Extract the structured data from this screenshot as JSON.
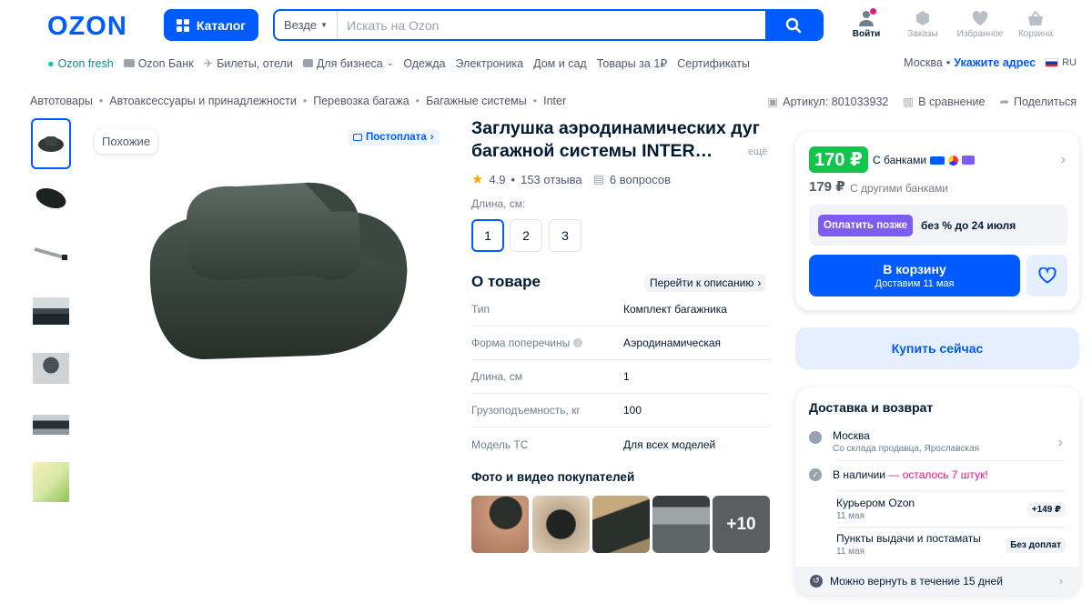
{
  "header": {
    "logo": "OZON",
    "catalog_label": "Каталог",
    "search_scope": "Везде",
    "search_placeholder": "Искать на Ozon",
    "icons": [
      {
        "label": "Войти",
        "icon": "user-icon"
      },
      {
        "label": "Заказы",
        "icon": "box-icon"
      },
      {
        "label": "Избранное",
        "icon": "heart-icon"
      },
      {
        "label": "Корзина",
        "icon": "basket-icon"
      }
    ]
  },
  "nav": {
    "items": [
      "Ozon fresh",
      "Ozon Банк",
      "Билеты, отели",
      "Для бизнеса",
      "Одежда",
      "Электроника",
      "Дом и сад",
      "Товары за 1₽",
      "Сертификаты"
    ],
    "city": "Москва",
    "address_link": "Укажите адрес",
    "lang": "RU"
  },
  "breadcrumbs": [
    "Автотовары",
    "Автоаксессуары и принадлежности",
    "Перевозка багажа",
    "Багажные системы",
    "Inter"
  ],
  "meta": {
    "article": "Артикул: 801033932",
    "compare": "В сравнение",
    "share": "Поделиться"
  },
  "gallery": {
    "similar_label": "Похожие",
    "postoplata_label": "Постоплата"
  },
  "product": {
    "title": "Заглушка аэродинамических дуг багажной системы INTER…",
    "more": "ещё",
    "rating": "4.9",
    "reviews": "153 отзыва",
    "questions": "6 вопросов",
    "length_label": "Длина, см:",
    "lengths": [
      "1",
      "2",
      "3"
    ],
    "about_title": "О товаре",
    "go_description": "Перейти к описанию",
    "specs": [
      {
        "k": "Тип",
        "v": "Комплект багажника"
      },
      {
        "k": "Форма поперечины",
        "v": "Аэродинамическая"
      },
      {
        "k": "Длина, см",
        "v": "1"
      },
      {
        "k": "Грузоподъемность, кг",
        "v": "100"
      },
      {
        "k": "Модель ТС",
        "v": "Для всех моделей"
      }
    ],
    "photos_title": "Фото и видео покупателей",
    "photos_more": "+10"
  },
  "buy": {
    "price": "170 ₽",
    "price_bank_label": "С банками",
    "price_other": "179 ₽",
    "price_other_label": "С другими банками",
    "paylater_btn": "Оплатить позже",
    "paylater_text": "без % до 24 июля",
    "cart_label": "В корзину",
    "cart_sub": "Доставим 11 мая",
    "buy_now": "Купить сейчас"
  },
  "delivery": {
    "title": "Доставка и возврат",
    "city": "Москва",
    "city_sub": "Со склада продавца, Ярославская",
    "stock": "В наличии",
    "stock_left": "— осталось 7 штук!",
    "courier": "Курьером Ozon",
    "courier_date": "11 мая",
    "courier_price": "+149 ₽",
    "pickup": "Пункты выдачи и постаматы",
    "pickup_date": "11 мая",
    "pickup_price": "Без доплат",
    "return": "Можно вернуть в течение 15 дней"
  },
  "colors": {
    "accent": "#005bff",
    "green": "#10c44c",
    "purple": "#7d5cf2"
  }
}
